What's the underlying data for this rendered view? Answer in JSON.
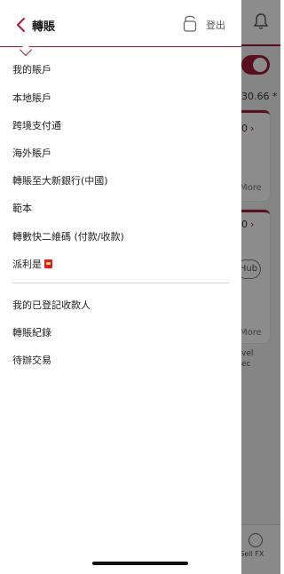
{
  "header": {
    "title": "轉賬",
    "logout_label": "登出"
  },
  "menu": {
    "items": [
      {
        "label": "我的賬戶"
      },
      {
        "label": "本地賬戶"
      },
      {
        "label": "跨境支付通"
      },
      {
        "label": "海外賬戶"
      },
      {
        "label": "轉賬至大新銀行(中國)"
      },
      {
        "label": "範本"
      },
      {
        "label": "轉數快二維碼 (付款/收款)"
      },
      {
        "label": "派利是",
        "icon": "red-packet-icon"
      }
    ],
    "secondary_items": [
      {
        "label": "我的已登記收款人"
      },
      {
        "label": "轉賬紀錄"
      },
      {
        "label": "待辦交易"
      }
    ]
  },
  "background": {
    "balance_fragment": "30.66 *",
    "card1_value": "0",
    "more_label_1": "More",
    "card2_value": "0",
    "hub_label": "Hub",
    "more_label_2": "More",
    "side_text_line1": "vel",
    "side_text_line2": "ec",
    "fx_label": "/ Sell FX"
  },
  "colors": {
    "accent": "#a31c37",
    "redpacket": "#e02020"
  },
  "icons": {
    "back": "chevron-left-icon",
    "lock": "lock-icon",
    "bell": "bell-icon",
    "fx": "fx-icon"
  }
}
